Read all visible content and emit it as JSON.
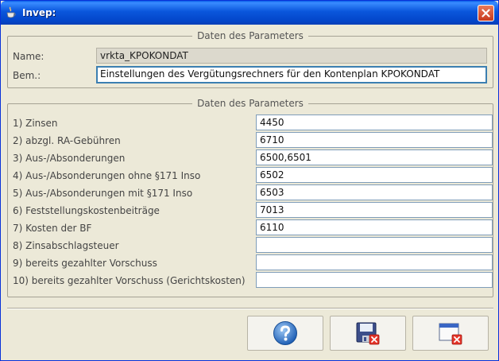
{
  "window": {
    "title": "Invep:"
  },
  "top_group": {
    "title": "Daten des Parameters",
    "name_label": "Name:",
    "name_value": "vrkta_KPOKONDAT",
    "bem_label": "Bem.:",
    "bem_value": "Einstellungen des Vergütungsrechners für den Kontenplan KPOKONDAT"
  },
  "params_group": {
    "title": "Daten des Parameters",
    "rows": [
      {
        "label": "1) Zinsen",
        "value": "4450"
      },
      {
        "label": "2) abzgl. RA-Gebühren",
        "value": "6710"
      },
      {
        "label": "3) Aus-/Absonderungen",
        "value": "6500,6501"
      },
      {
        "label": "4) Aus-/Absonderungen ohne §171 Inso",
        "value": "6502"
      },
      {
        "label": "5) Aus-/Absonderungen mit §171 Inso",
        "value": "6503"
      },
      {
        "label": "6) Feststellungskostenbeiträge",
        "value": "7013"
      },
      {
        "label": "7) Kosten der BF",
        "value": "6110"
      },
      {
        "label": "8) Zinsabschlagsteuer",
        "value": ""
      },
      {
        "label": "9) bereits gezahlter Vorschuss",
        "value": ""
      },
      {
        "label": "10) bereits gezahlter Vorschuss (Gerichtskosten)",
        "value": ""
      }
    ]
  },
  "buttons": {
    "help_icon": "help-question-icon",
    "save_icon": "save-cancel-icon",
    "close_icon": "window-cancel-icon"
  },
  "colors": {
    "titlebar": "#0a56dc",
    "close": "#c8391c",
    "field_border": "#7f9db9"
  }
}
